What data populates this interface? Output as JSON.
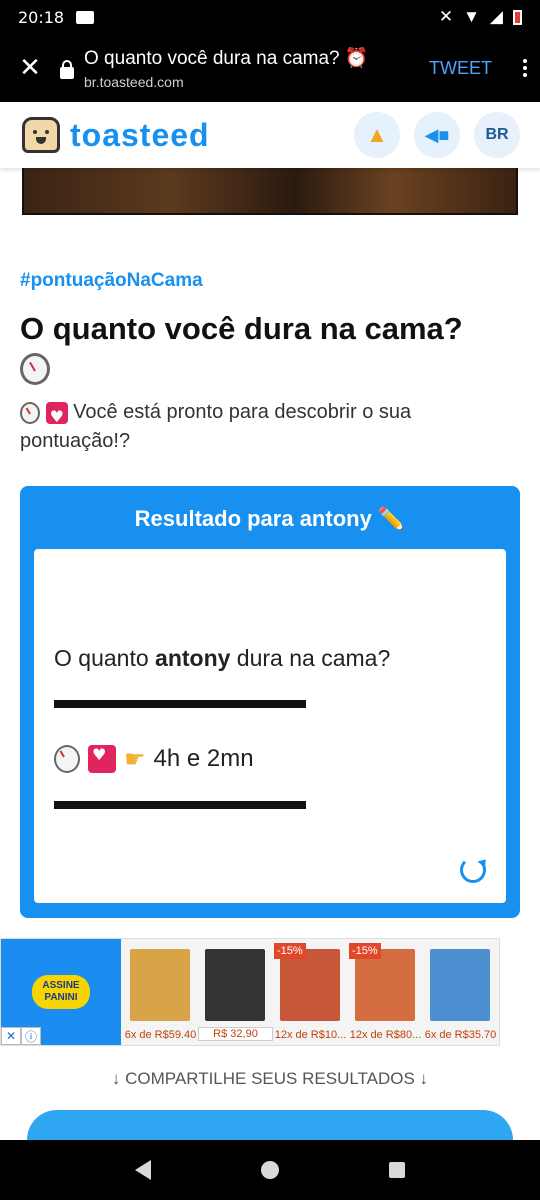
{
  "status": {
    "time": "20:18"
  },
  "browser": {
    "title": "O quanto você dura na cama? ⏰",
    "host": "br.toasteed.com",
    "tweet_label": "TWEET"
  },
  "site": {
    "logo_text": "toasteed",
    "lang_label": "BR"
  },
  "article": {
    "hashtag": "#pontuaçãoNaCama",
    "heading": "O quanto você dura na cama?",
    "intro": "Você está pronto para descobrir o sua pontuação!?"
  },
  "result_card": {
    "title": "Resultado para antony ✏️",
    "question_prefix": "O quanto ",
    "question_name": "antony",
    "question_suffix": " dura na cama?",
    "result_value": "4h e 2mn"
  },
  "ad": {
    "badge_line1": "ASSINE",
    "badge_line2": "PANINI",
    "products": [
      {
        "price": "6x de R$59.40",
        "discount": "",
        "color": "#d9a347"
      },
      {
        "price": "R$ 32,90",
        "discount": "",
        "color": "#333333"
      },
      {
        "price": "12x de R$10...",
        "discount": "-15%",
        "color": "#c8573a"
      },
      {
        "price": "12x de R$80...",
        "discount": "-15%",
        "color": "#d46d3f"
      },
      {
        "price": "6x de R$35.70",
        "discount": "",
        "color": "#4d8fd1"
      }
    ]
  },
  "share_label": "↓ COMPARTILHE SEUS RESULTADOS ↓",
  "colors": {
    "accent": "#1890f0",
    "tweet": "#2ea6f2"
  }
}
